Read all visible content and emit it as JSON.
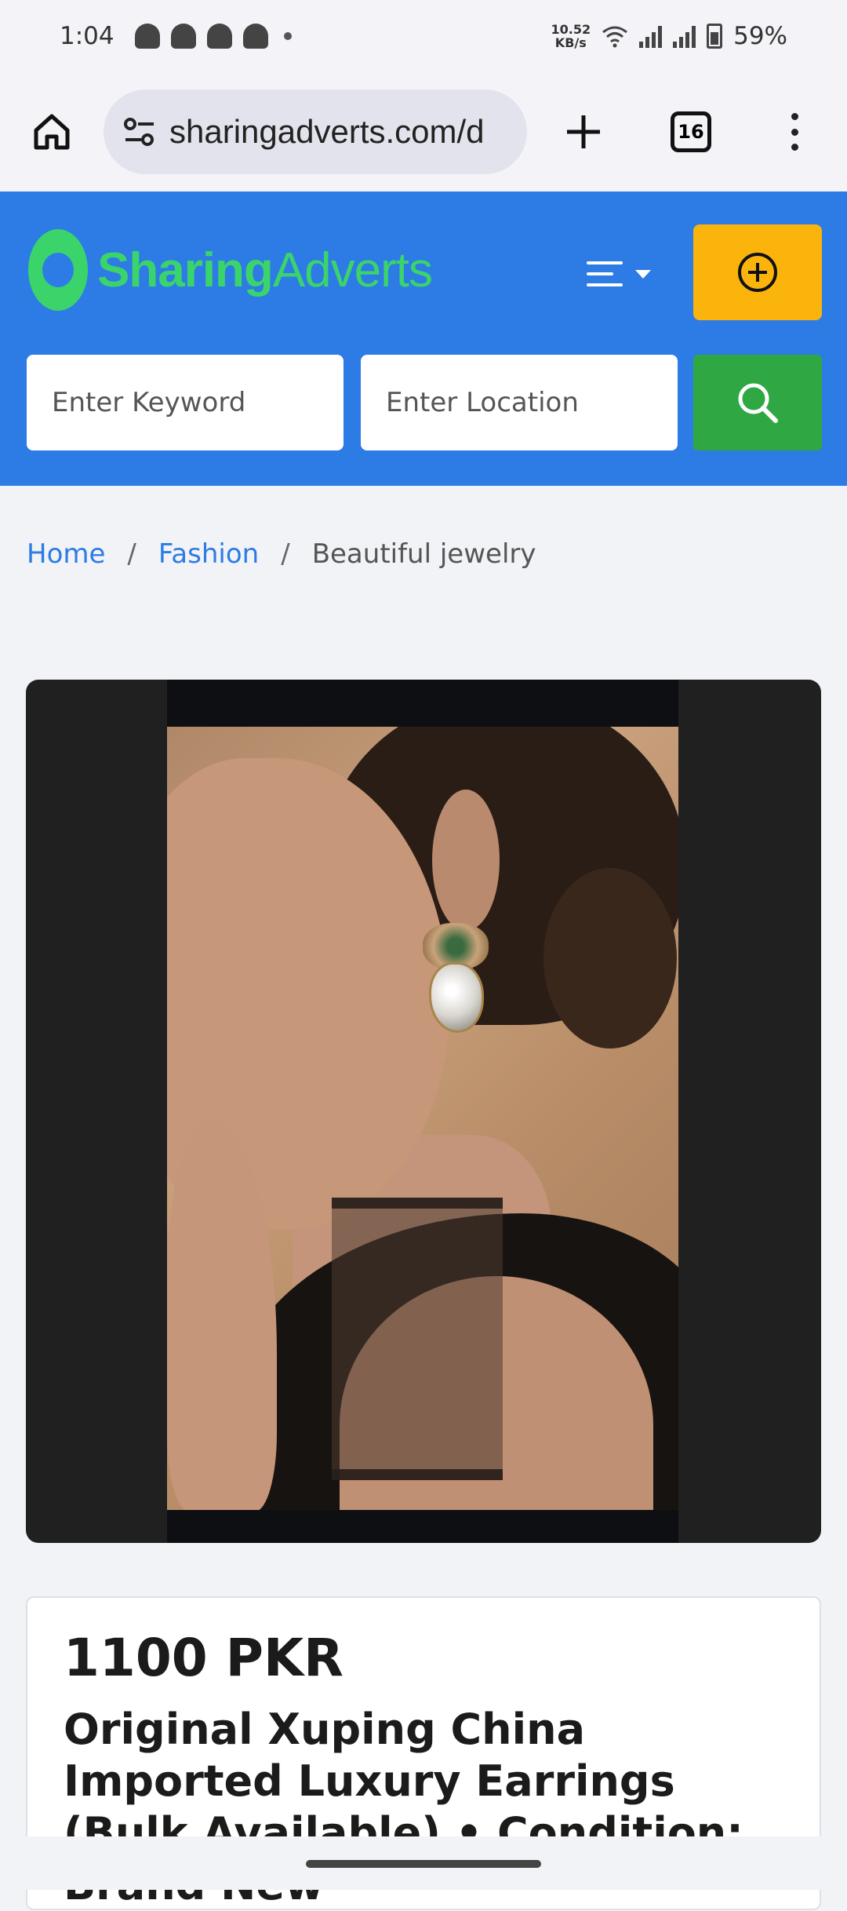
{
  "status_bar": {
    "time": "1:04",
    "net_speed_value": "10.52",
    "net_speed_unit": "KB/s",
    "battery": "59%"
  },
  "browser": {
    "url": "sharingadverts.com/d",
    "tab_count": "16"
  },
  "header": {
    "logo_bold": "Sharing",
    "logo_regular": "Adverts",
    "search": {
      "keyword_placeholder": "Enter Keyword",
      "location_placeholder": "Enter Location"
    },
    "colors": {
      "header_bg": "#2d7be5",
      "post_button": "#fbb40b",
      "search_button": "#2fa843",
      "logo": "#3bd46b"
    }
  },
  "breadcrumb": {
    "items": [
      {
        "label": "Home"
      },
      {
        "label": "Fashion"
      },
      {
        "label": "Beautiful jewelry"
      }
    ],
    "separator": "/"
  },
  "listing": {
    "price": "1100 PKR",
    "title": "Original Xuping China Imported Luxury Earrings (Bulk Available) • Condition: Brand New"
  }
}
